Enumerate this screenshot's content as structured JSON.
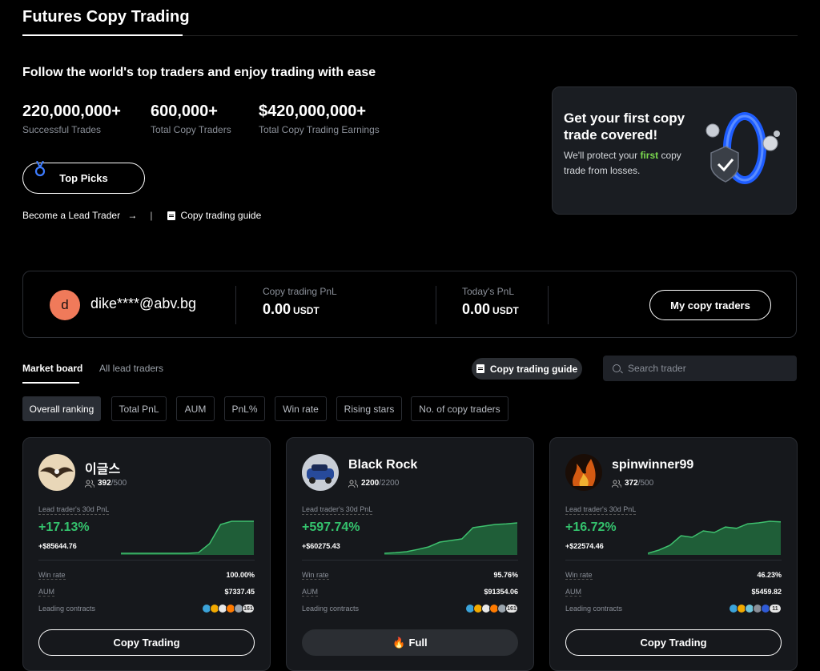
{
  "header": {
    "title": "Futures Copy Trading"
  },
  "hero": {
    "tagline": "Follow the world's top traders and enjoy trading with ease",
    "stats": [
      {
        "value": "220,000,000+",
        "label": "Successful Trades"
      },
      {
        "value": "600,000+",
        "label": "Total Copy Traders"
      },
      {
        "value": "$420,000,000+",
        "label": "Total Copy Trading Earnings"
      }
    ],
    "top_picks_label": "Top Picks",
    "become_lead_label": "Become a Lead Trader",
    "arrow": "→",
    "separator": "|",
    "guide_label": "Copy trading guide"
  },
  "promo": {
    "title": "Get your first copy trade covered!",
    "text_before": "We'll protect your ",
    "text_highlight": "first",
    "text_after": " copy trade from losses."
  },
  "user": {
    "avatar_letter": "d",
    "email": "dike****@abv.bg",
    "copy_pnl_label": "Copy trading PnL",
    "copy_pnl_value": "0.00",
    "today_pnl_label": "Today's PnL",
    "today_pnl_value": "0.00",
    "currency": "USDT",
    "my_copy_traders_label": "My copy traders"
  },
  "board": {
    "tabs": [
      "Market board",
      "All lead traders"
    ],
    "guide_chip_label": "Copy trading guide",
    "search_placeholder": "Search trader",
    "filters": [
      "Overall ranking",
      "Total PnL",
      "AUM",
      "PnL%",
      "Win rate",
      "Rising stars",
      "No. of copy traders"
    ]
  },
  "traders": [
    {
      "name": "이글스",
      "followers": "392",
      "capacity": "/500",
      "pnl_label": "Lead trader's 30d PnL",
      "pnl_pct": "+17.13%",
      "pnl_abs": "+$85644.76",
      "spark": [
        0,
        0,
        0,
        0,
        0,
        0,
        0,
        0.02,
        0.3,
        0.9,
        1,
        1,
        1
      ],
      "win_rate_label": "Win rate",
      "win_rate": "100.00%",
      "aum_label": "AUM",
      "aum": "$7337.45",
      "contracts_label": "Leading contracts",
      "more": "161",
      "coin_colors": [
        "#3ba3d9",
        "#f2a900",
        "#e8e8e8",
        "#ff7a00",
        "#9aa4ad"
      ],
      "cta": "Copy Trading",
      "full": false
    },
    {
      "name": "Black Rock",
      "followers": "2200",
      "capacity": "/2200",
      "pnl_label": "Lead trader's 30d PnL",
      "pnl_pct": "+597.74%",
      "pnl_abs": "+$60275.43",
      "spark": [
        0,
        0.02,
        0.05,
        0.12,
        0.2,
        0.35,
        0.4,
        0.45,
        0.8,
        0.85,
        0.9,
        0.92,
        0.95
      ],
      "win_rate_label": "Win rate",
      "win_rate": "95.76%",
      "aum_label": "AUM",
      "aum": "$91354.06",
      "contracts_label": "Leading contracts",
      "more": "161",
      "coin_colors": [
        "#3ba3d9",
        "#f2a900",
        "#e8e8e8",
        "#ff7a00",
        "#9aa4ad"
      ],
      "cta": "Full",
      "full": true,
      "cta_icon": "🔥"
    },
    {
      "name": "spinwinner99",
      "followers": "372",
      "capacity": "/500",
      "pnl_label": "Lead trader's 30d PnL",
      "pnl_pct": "+16.72%",
      "pnl_abs": "+$22574.46",
      "spark": [
        0,
        0.1,
        0.25,
        0.55,
        0.5,
        0.7,
        0.65,
        0.82,
        0.78,
        0.92,
        0.95,
        1,
        0.98
      ],
      "win_rate_label": "Win rate",
      "win_rate": "46.23%",
      "aum_label": "AUM",
      "aum": "$5459.82",
      "contracts_label": "Leading contracts",
      "more": "11",
      "coin_colors": [
        "#3ba3d9",
        "#f2a900",
        "#6fc3d9",
        "#8a8f98",
        "#2f5ad6"
      ],
      "cta": "Copy Trading",
      "full": false
    }
  ]
}
